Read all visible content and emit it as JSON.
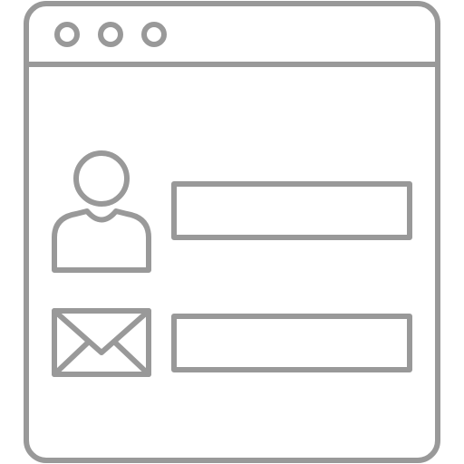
{
  "icon": {
    "kind": "browser-window-contact-form-icon",
    "stroke_color": "#999999",
    "background": "#ffffff",
    "window_control_dots": 3,
    "form_rows": [
      {
        "icon": "user-icon",
        "field": "name-field"
      },
      {
        "icon": "envelope-icon",
        "field": "email-field"
      }
    ]
  }
}
